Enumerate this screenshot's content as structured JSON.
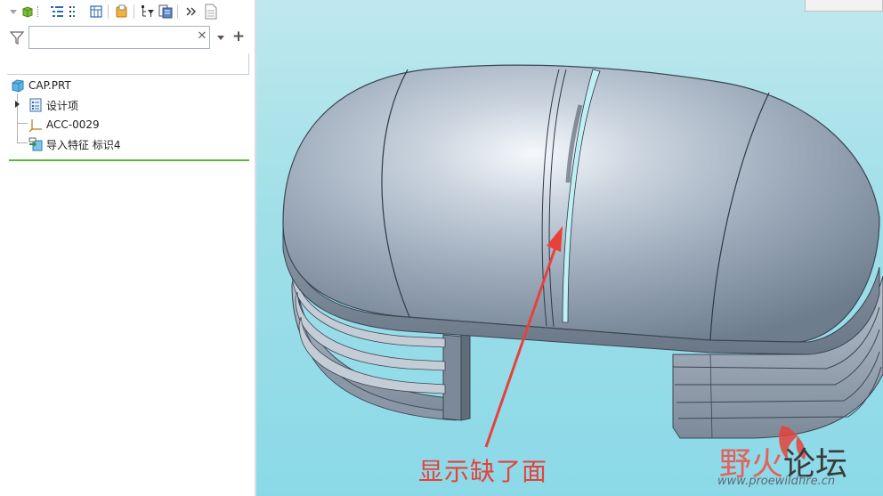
{
  "model_tree": {
    "filter_placeholder": "",
    "root": "CAP.PRT",
    "items": [
      {
        "label": "设计项",
        "icon": "design-items-icon",
        "expandable": true
      },
      {
        "label": "ACC-0029",
        "icon": "coordinate-system-icon",
        "expandable": false
      },
      {
        "label": "导入特征 标识4",
        "icon": "import-feature-icon",
        "expandable": false
      }
    ]
  },
  "toolbar": {
    "icons": [
      "show-icon",
      "tree-columns-icon",
      "tree-filters-icon",
      "settings-icon",
      "folder-icon",
      "tree-filter-icon",
      "layer-tree-icon",
      "more-icon",
      "notes-icon"
    ]
  },
  "annotation": {
    "text": "显示缺了面",
    "color": "#e8413a"
  },
  "watermark": {
    "name_part1": "野火",
    "name_part2": "论坛",
    "url": "www.proewildfire.cn"
  },
  "colors": {
    "viewport_top": "#bfe8ee",
    "viewport_bottom": "#8bd9e8",
    "model_body": "#a9b5c4",
    "insert_marker": "#5ab53c"
  }
}
